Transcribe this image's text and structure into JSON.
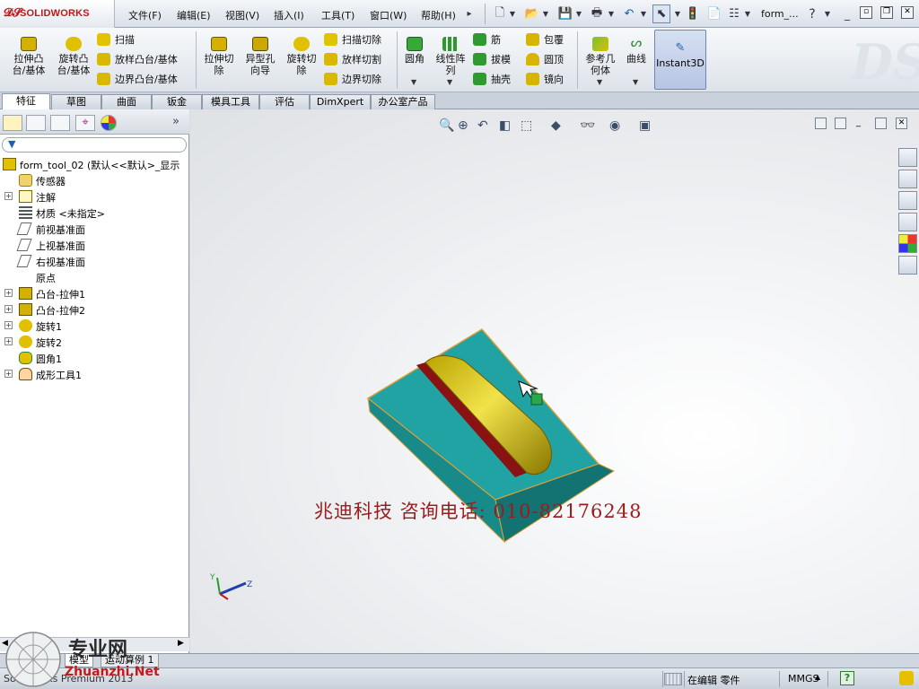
{
  "app": {
    "brand": "SOLIDWORKS",
    "title_doc": "form_..."
  },
  "menu": [
    "文件(F)",
    "编辑(E)",
    "视图(V)",
    "插入(I)",
    "工具(T)",
    "窗口(W)",
    "帮助(H)"
  ],
  "commands": {
    "extrude_boss": "拉伸凸\n台/基体",
    "revolve_boss": "旋转凸\n台/基体",
    "sweep": "扫描",
    "loft_boss": "放样凸台/基体",
    "boundary_boss": "边界凸台/基体",
    "extrude_cut": "拉伸切\n除",
    "hole_wizard": "异型孔\n向导",
    "revolve_cut": "旋转切\n除",
    "sweep_cut": "扫描切除",
    "loft_cut": "放样切割",
    "boundary_cut": "边界切除",
    "fillet": "圆角",
    "linear_pattern": "线性阵\n列",
    "rib": "筋",
    "draft": "拔模",
    "shell": "抽壳",
    "wrap": "包覆",
    "dome": "圆顶",
    "mirror": "镜向",
    "ref_geometry": "参考几\n何体",
    "curves": "曲线",
    "instant3d": "Instant3D"
  },
  "tabs": [
    "特征",
    "草图",
    "曲面",
    "钣金",
    "模具工具",
    "评估",
    "DimXpert",
    "办公室产品"
  ],
  "active_tab": "特征",
  "tree": {
    "root": "form_tool_02  (默认<<默认>_显示",
    "items": [
      {
        "label": "传感器",
        "expandable": false,
        "icon": "sensor-icon"
      },
      {
        "label": "注解",
        "expandable": true,
        "icon": "annotation-icon"
      },
      {
        "label": "材质 <未指定>",
        "expandable": false,
        "icon": "material-icon"
      },
      {
        "label": "前视基准面",
        "expandable": false,
        "icon": "plane-icon"
      },
      {
        "label": "上视基准面",
        "expandable": false,
        "icon": "plane-icon"
      },
      {
        "label": "右视基准面",
        "expandable": false,
        "icon": "plane-icon"
      },
      {
        "label": "原点",
        "expandable": false,
        "icon": "origin-icon"
      },
      {
        "label": "凸台-拉伸1",
        "expandable": true,
        "icon": "extrude-icon"
      },
      {
        "label": "凸台-拉伸2",
        "expandable": true,
        "icon": "extrude-icon"
      },
      {
        "label": "旋转1",
        "expandable": true,
        "icon": "revolve-icon"
      },
      {
        "label": "旋转2",
        "expandable": true,
        "icon": "revolve-icon"
      },
      {
        "label": "圆角1",
        "expandable": false,
        "icon": "fillet-icon"
      },
      {
        "label": "成形工具1",
        "expandable": true,
        "icon": "form-tool-icon"
      }
    ]
  },
  "viewport": {
    "overlay_text": "兆迪科技    咨询电话: 010-82176248",
    "triad": {
      "y": "Y",
      "z": "Z"
    }
  },
  "bottom_tabs": [
    "模型",
    "运动算例 1"
  ],
  "status": {
    "left": "SolidWorks Premium 2013",
    "editing": "在编辑 零件",
    "units": "MMGS",
    "help": "?"
  },
  "watermark": {
    "brand": "专业网",
    "site": "Zhuanzhi.Net"
  },
  "colors": {
    "accent": "#c4161c",
    "part_face": "#1f9e9e",
    "part_edge": "#e8a020",
    "tool_yellow": "#c8b400",
    "tool_red": "#8b1010"
  }
}
